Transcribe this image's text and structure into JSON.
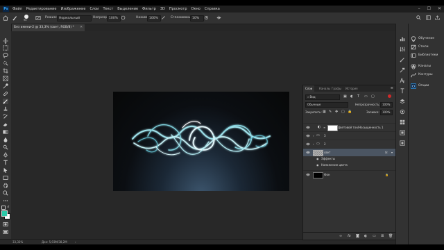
{
  "menubar": {
    "logo": "Ps",
    "items": [
      "Файл",
      "Редактирование",
      "Изображение",
      "Слои",
      "Текст",
      "Выделение",
      "Фильтр",
      "3D",
      "Просмотр",
      "Окно",
      "Справка"
    ]
  },
  "options": {
    "size": "90",
    "mode_label": "Режим:",
    "mode_value": "Нормальный",
    "opacity_label": "Непрозр.:",
    "opacity_value": "100%",
    "flow_label": "Нажим:",
    "flow_value": "100%",
    "smoothing_label": "Сглаживание:",
    "smoothing_value": "10%"
  },
  "document": {
    "tab_title": "Без имени-2 @ 33,3% (свет, RGB/8) *"
  },
  "status": {
    "zoom": "33,33%",
    "doc_size": "Док: 5,93М/38,2М"
  },
  "right_panel": {
    "items": [
      {
        "label": "Обучение",
        "icon": "lightbulb-icon"
      },
      {
        "label": "Стили",
        "icon": "styles-icon"
      },
      {
        "label": "Библиотеки",
        "icon": "libraries-icon"
      },
      {
        "label": "Каналы",
        "icon": "channels-icon"
      },
      {
        "label": "Контуры",
        "icon": "paths-icon"
      },
      {
        "label": "Опции",
        "icon": "options-icon"
      }
    ]
  },
  "layers_panel": {
    "tabs": [
      "Слои",
      "Каналы",
      "Графы",
      "История"
    ],
    "search_value": "Вид",
    "blend_mode": "Обычные",
    "opacity_label": "Непрозрачность:",
    "opacity_value": "100%",
    "lock_label": "Закрепить:",
    "fill_label": "Заливка:",
    "fill_value": "100%",
    "layers": [
      {
        "name": "Цветовой тон/Насыщенность 1",
        "type": "adjustment"
      },
      {
        "name": "3",
        "type": "group"
      },
      {
        "name": "2",
        "type": "group"
      },
      {
        "name": "свет",
        "type": "pixel",
        "selected": true,
        "fx": "fx"
      },
      {
        "name": "Эффекты",
        "type": "effects"
      },
      {
        "name": "Наложение цвета",
        "type": "effect"
      },
      {
        "name": "Фон",
        "type": "background"
      }
    ]
  },
  "colors": {
    "foreground": "#2cc9a8",
    "background": "#ffffff",
    "accent": "#31a8ff",
    "selection": "#4b5562"
  }
}
